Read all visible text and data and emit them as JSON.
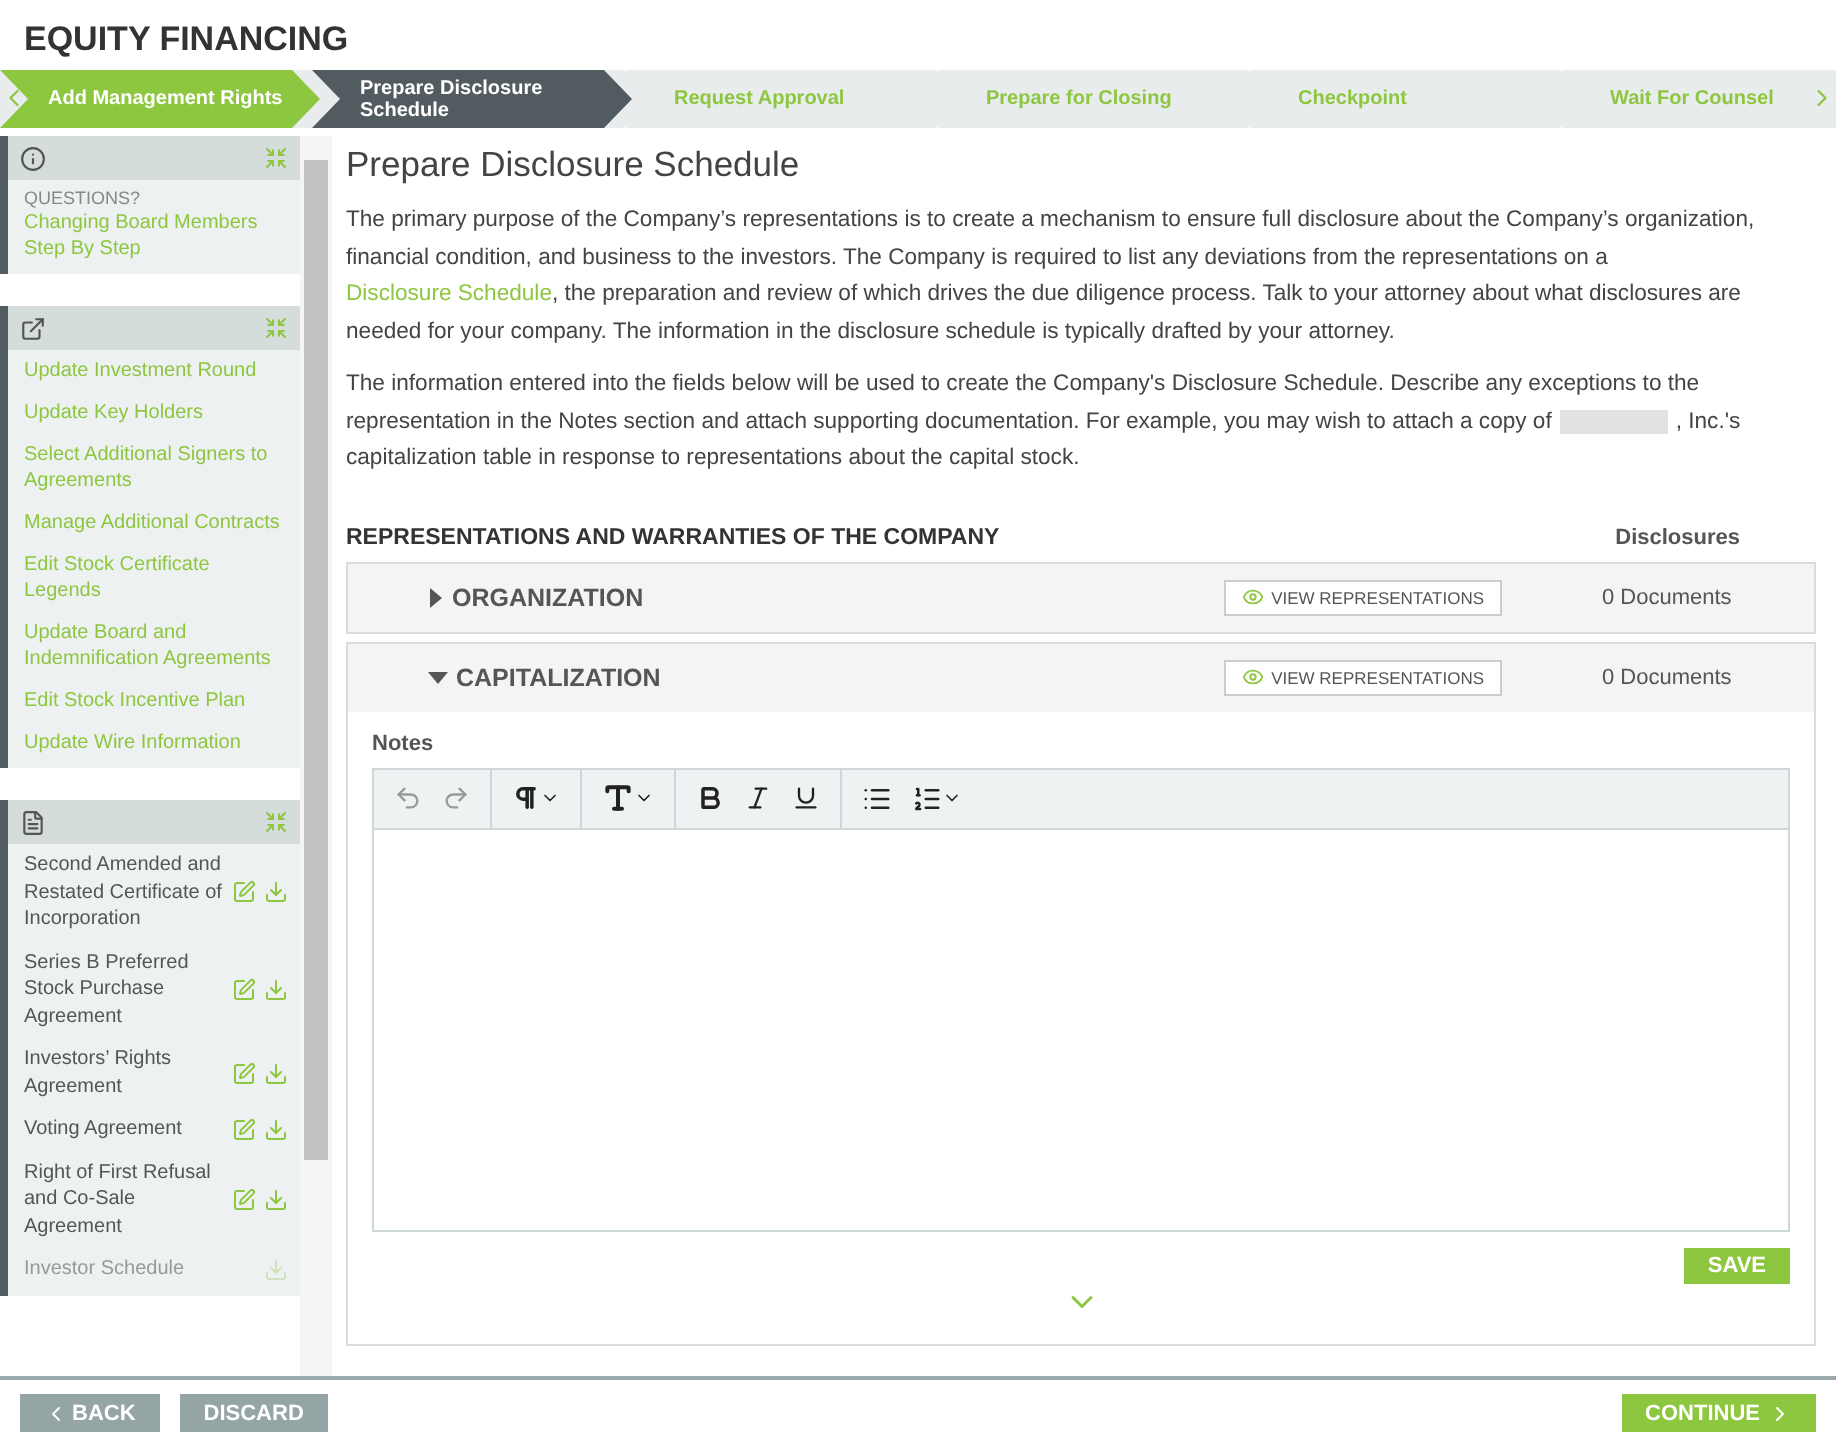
{
  "title": "EQUITY FINANCING",
  "steps": [
    {
      "label": "Add Management Rights",
      "completed": true,
      "selected": false
    },
    {
      "label": "Prepare Disclosure Schedule",
      "completed": false,
      "selected": true
    },
    {
      "label": "Request Approval",
      "completed": false,
      "selected": false
    },
    {
      "label": "Prepare for Closing",
      "completed": false,
      "selected": false
    },
    {
      "label": "Checkpoint",
      "completed": false,
      "selected": false
    },
    {
      "label": "Wait For Counsel",
      "completed": false,
      "selected": false
    }
  ],
  "sidebar": {
    "panels": [
      {
        "kind": "info",
        "caption": "QUESTIONS?",
        "links": [
          "Changing Board Members Step By Step"
        ]
      },
      {
        "kind": "links",
        "links": [
          "Update Investment Round",
          "Update Key Holders",
          "Select Additional Signers to Agreements",
          "Manage Additional Contracts",
          "Edit Stock Certificate Legends",
          "Update Board and Indemnification Agreements",
          "Edit Stock Incentive Plan",
          "Update Wire Information"
        ]
      },
      {
        "kind": "documents",
        "documents": [
          {
            "name": "Second Amended and Restated Certificate of Incorporation",
            "editable": true,
            "disabled": false
          },
          {
            "name": "Series B Preferred Stock Purchase Agreement",
            "editable": true,
            "disabled": false
          },
          {
            "name": "Investors’ Rights Agreement",
            "editable": true,
            "disabled": false
          },
          {
            "name": "Voting Agreement",
            "editable": true,
            "disabled": false
          },
          {
            "name": "Right of First Refusal and Co-Sale Agreement",
            "editable": true,
            "disabled": false
          },
          {
            "name": "Investor Schedule",
            "editable": false,
            "disabled": true
          }
        ]
      }
    ]
  },
  "main": {
    "heading": "Prepare Disclosure Schedule",
    "intro": {
      "before": "The primary purpose of the Company’s representations is to create a mechanism to ensure full disclosure about the Company’s organization, financial condition, and business to the investors. The Company is required to list any deviations from the representations on a ",
      "link": "Disclosure Schedule",
      "after": ", the preparation and review of which drives the due diligence process. Talk to your attorney about what disclosures are needed for your company. The information in the disclosure schedule is typically drafted by your attorney."
    },
    "instructions": {
      "before": "The information entered into the fields below will be used to create the Company's Disclosure Schedule. Describe any exceptions to the representation in the Notes section and attach supporting documentation. For example, you may wish to attach a copy of",
      "after": ", Inc.'s capitalization table in response to representations about the capital stock."
    },
    "section_title": "REPRESENTATIONS AND WARRANTIES OF THE COMPANY",
    "disclosures_header": "Disclosures",
    "sections": [
      {
        "name": "ORGANIZATION",
        "expanded": false,
        "action": "VIEW REPRESENTATIONS",
        "documents": "0 Documents"
      },
      {
        "name": "CAPITALIZATION",
        "expanded": true,
        "action": "VIEW REPRESENTATIONS",
        "documents": "0 Documents",
        "notes_label": "Notes",
        "save": "SAVE"
      }
    ]
  },
  "footer": {
    "back": "BACK",
    "discard": "DISCARD",
    "continue": "CONTINUE"
  }
}
